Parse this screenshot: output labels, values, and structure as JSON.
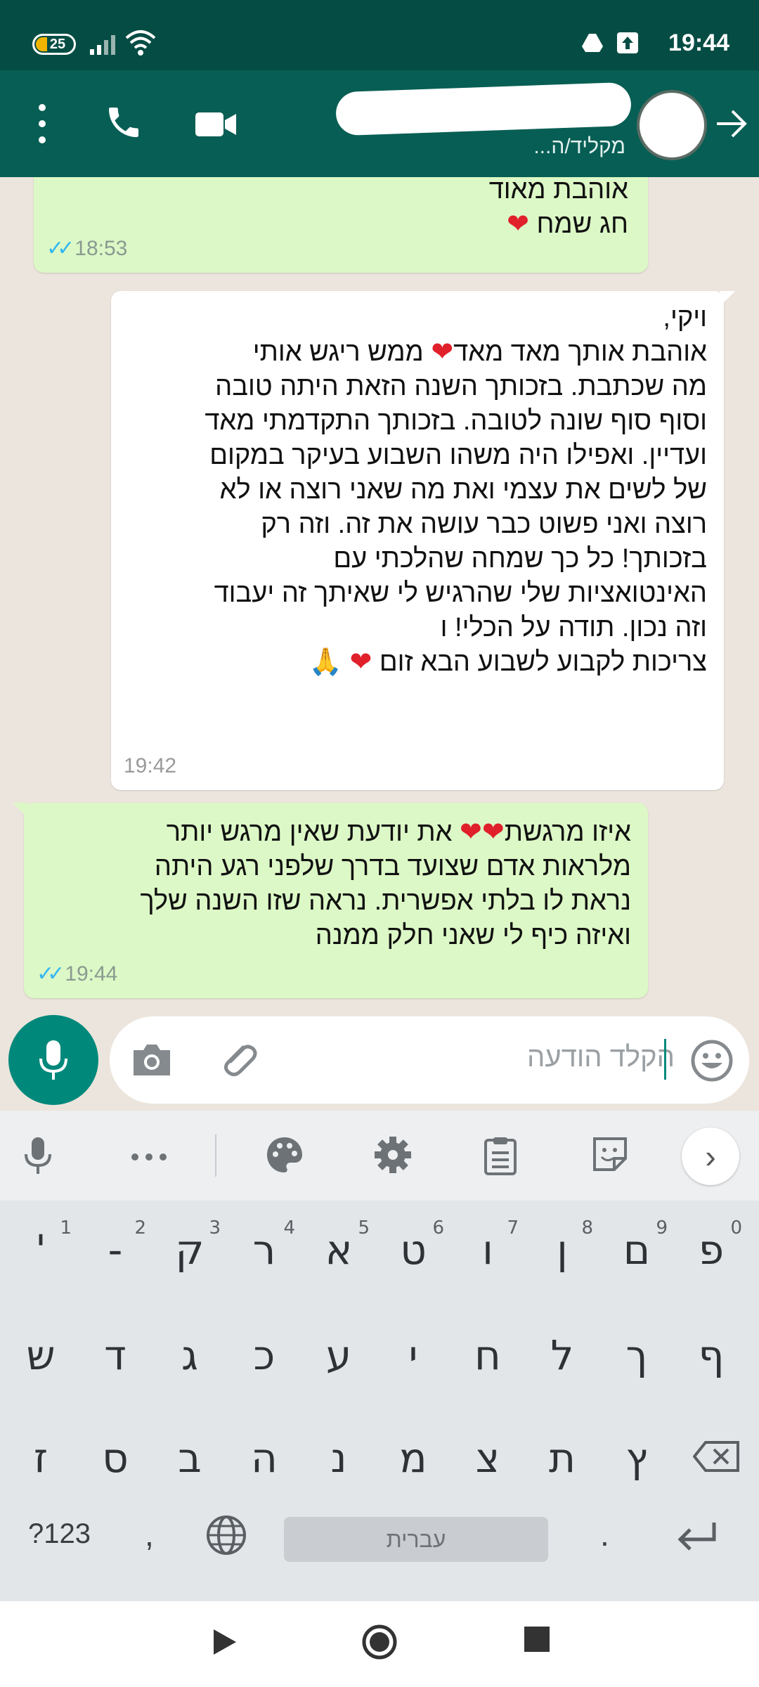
{
  "status_bar": {
    "time": "19:44",
    "battery": "25",
    "icons": [
      "signal-icon",
      "wifi-icon",
      "drive-icon",
      "upload-icon"
    ]
  },
  "header": {
    "subtitle": "מקליד/ה...",
    "icons": [
      "back-arrow-icon",
      "avatar",
      "video-call-icon",
      "phone-icon",
      "more-vert-icon"
    ]
  },
  "messages": [
    {
      "direction": "out",
      "lines": [
        "אוהבת מאוד",
        "חג שמח"
      ],
      "time": "18:53",
      "status": "read"
    },
    {
      "direction": "in",
      "lines": [
        "ויקי,",
        "אוהבת אותך מאד מאד",
        "ממש ריגש אותי",
        "מה שכתבת. בזכותך השנה הזאת היתה טובה",
        "וסוף סוף שונה לטובה. בזכותך התקדמתי מאד",
        "ועדיין. ואפילו היה משהו השבוע בעיקר במקום",
        "של לשים את עצמי ואת מה שאני רוצה או לא",
        "רוצה ואני פשוט כבר עושה את זה. וזה רק",
        "בזכותך! כל כך שמחה שהלכתי עם",
        "האינטואציות שלי שהרגיש לי שאיתך זה יעבוד",
        "וזה נכון. תודה על הכלי! ו",
        "צריכות לקבוע לשבוע הבא זום"
      ],
      "time": "19:42"
    },
    {
      "direction": "out",
      "lines": [
        "איזו מרגשת",
        "את יודעת שאין מרגש יותר",
        "מלראות אדם שצועד בדרך שלפני רגע היתה",
        "נראת לו בלתי אפשרית. נראה שזו השנה שלך",
        "ואיזה כיף לי שאני חלק ממנה"
      ],
      "time": "19:44",
      "status": "read"
    }
  ],
  "emoji": {
    "heart": "❤",
    "pray": "🙏",
    "ticks": "✓✓"
  },
  "input": {
    "placeholder": "הקלד הודעה"
  },
  "keyboard": {
    "toolbar": [
      "mic-icon",
      "more-icon",
      "palette-icon",
      "settings-icon",
      "clipboard-icon",
      "sticker-icon"
    ],
    "row1": [
      {
        "ch": "'",
        "num": "1"
      },
      {
        "ch": "-",
        "num": "2"
      },
      {
        "ch": "ק",
        "num": "3"
      },
      {
        "ch": "ר",
        "num": "4"
      },
      {
        "ch": "א",
        "num": "5"
      },
      {
        "ch": "ט",
        "num": "6"
      },
      {
        "ch": "ו",
        "num": "7"
      },
      {
        "ch": "ן",
        "num": "8"
      },
      {
        "ch": "ם",
        "num": "9"
      },
      {
        "ch": "פ",
        "num": "0"
      }
    ],
    "row2": [
      "ש",
      "ד",
      "ג",
      "כ",
      "ע",
      "י",
      "ח",
      "ל",
      "ך",
      "ף"
    ],
    "row3": [
      "ז",
      "ס",
      "ב",
      "ה",
      "נ",
      "מ",
      "צ",
      "ת",
      "ץ"
    ],
    "symbols_key": "?123",
    "comma_key": ",",
    "space_label": "עברית",
    "period_key": "."
  }
}
